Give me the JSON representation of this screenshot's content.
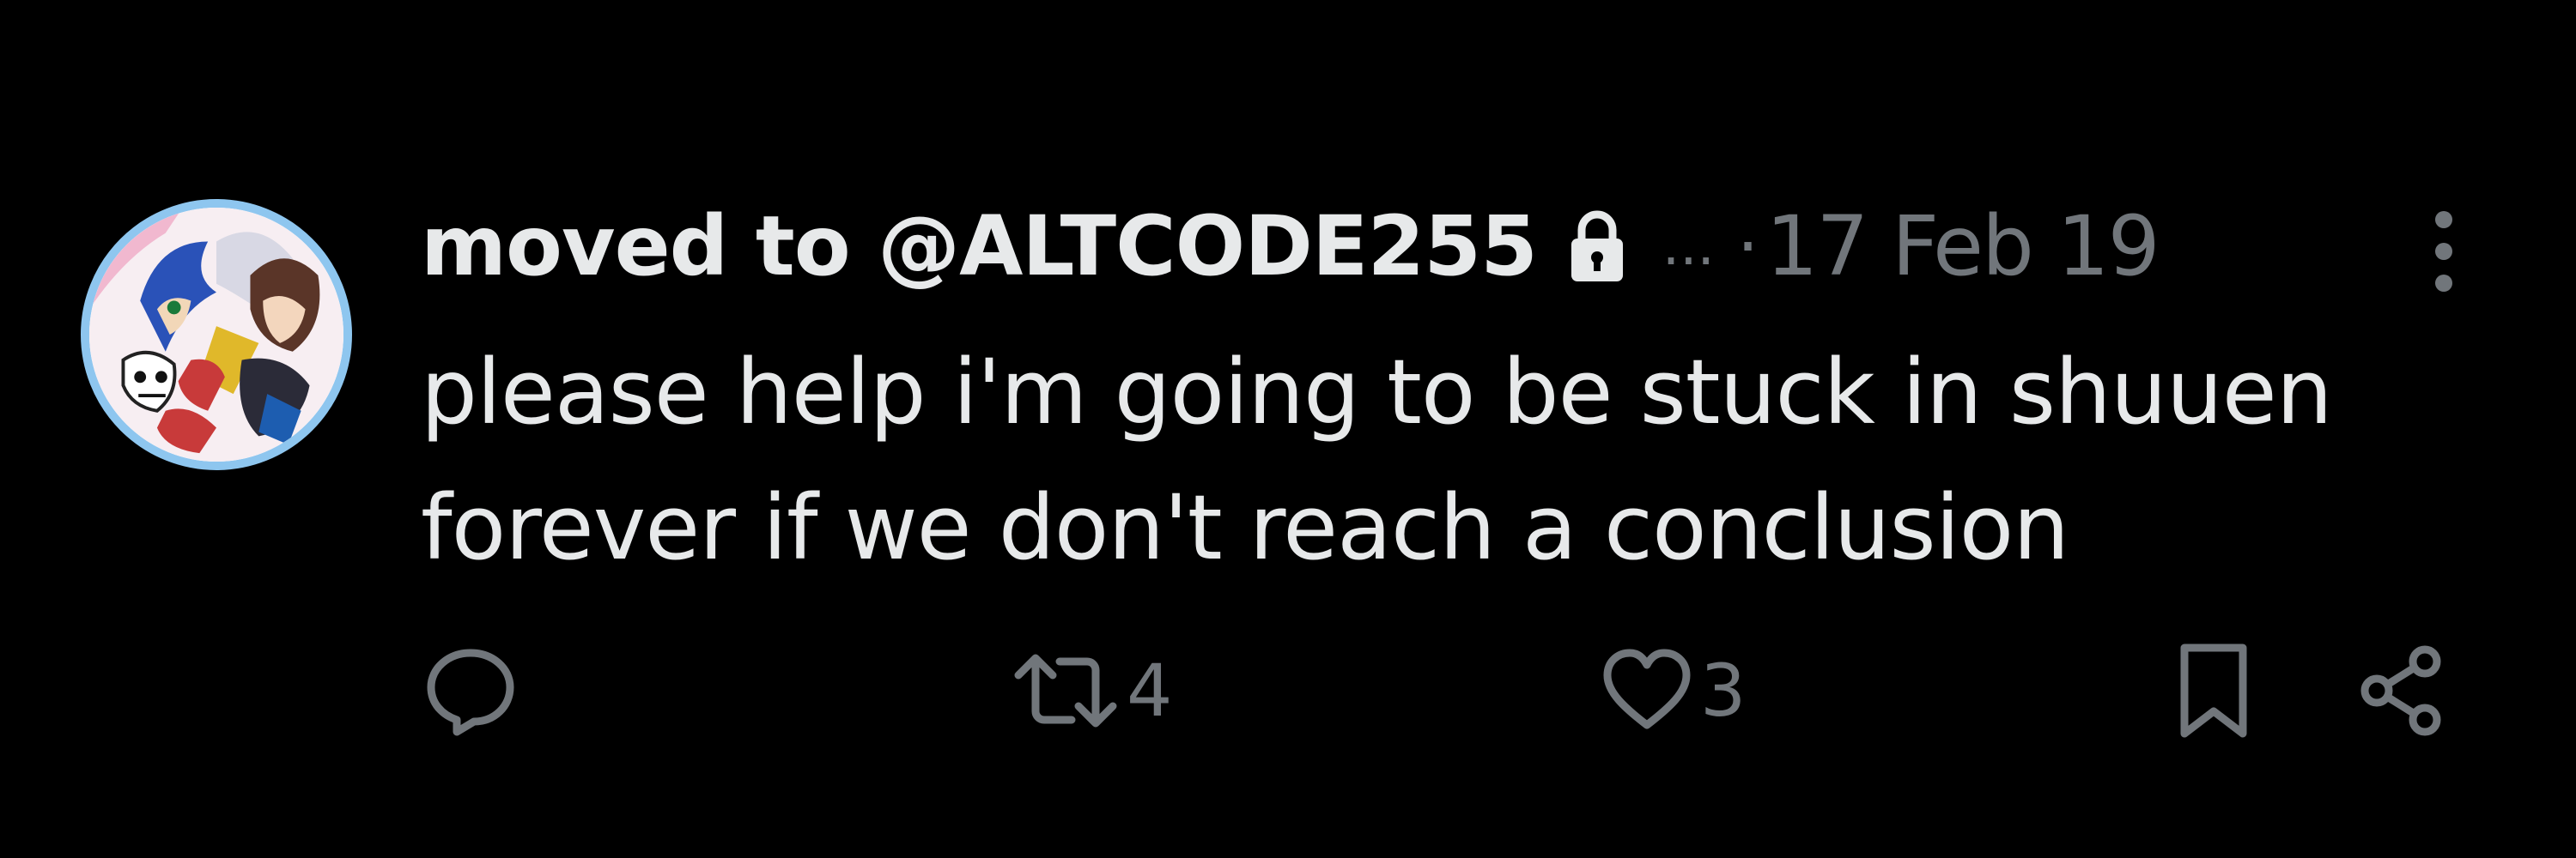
{
  "tweet": {
    "display_name": "moved to @ALTCODE255",
    "truncation": "...",
    "separator": "·",
    "timestamp": "17 Feb 19",
    "text_lines": [
      "please help i'm going to be stuck in shuuen",
      "forever if we don't reach a conclusion"
    ],
    "protected": true
  },
  "actions": {
    "reply_icon": "speech-bubble-icon",
    "retweet_count": "4",
    "like_count": "3",
    "bookmark_icon": "bookmark-icon",
    "share_icon": "share-icon"
  },
  "colors": {
    "background": "#000000",
    "primary_text": "#e7e9ea",
    "secondary_text": "#71767b",
    "avatar_ring": "#8ec6ef"
  }
}
